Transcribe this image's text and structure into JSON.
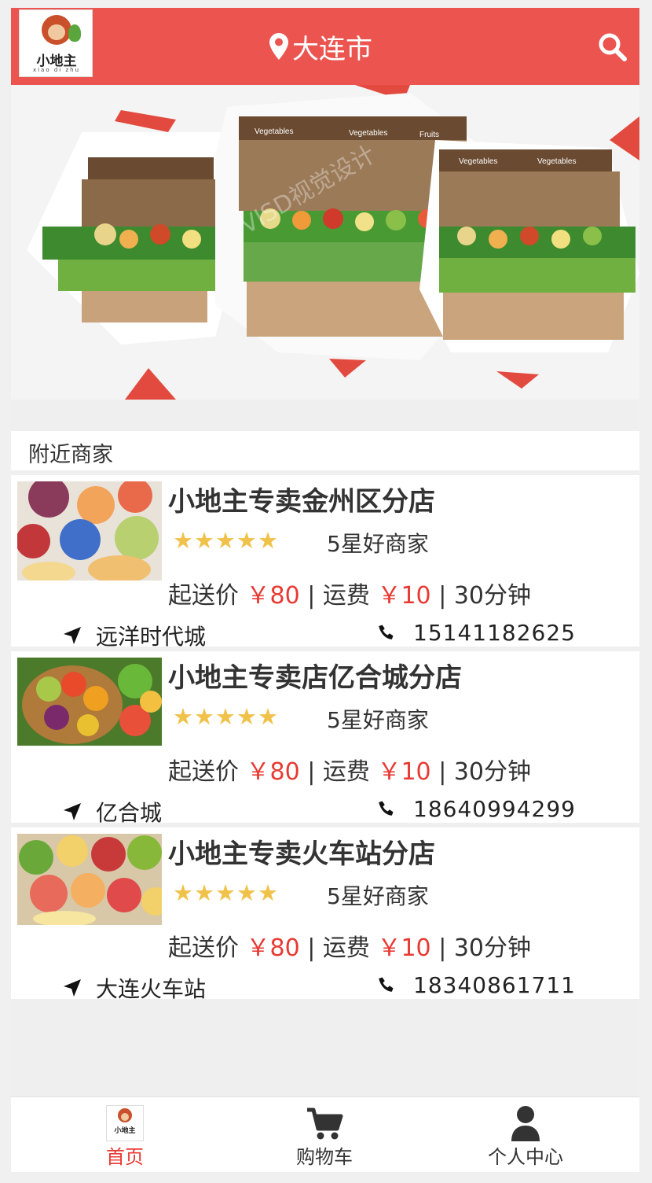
{
  "header": {
    "logo_text": "小地主",
    "logo_subtext": "xiao di zhu",
    "city": "大连市"
  },
  "banner": {
    "shelf_labels": [
      "Vegetables",
      "Vegetables",
      "Fruits",
      "Vegetables",
      "Vegetables"
    ],
    "watermark": "VISD视觉设计"
  },
  "section": {
    "title": "附近商家"
  },
  "stores": [
    {
      "name": "小地主专卖金州区分店",
      "stars": "★★★★★",
      "rating": "5星好商家",
      "min_label": "起送价",
      "min_price": "￥80",
      "sep1": " | ",
      "fee_label": "运费",
      "fee": "￥10",
      "sep2": " | ",
      "time": "30分钟",
      "address": "远洋时代城",
      "phone": "15141182625",
      "thumb_colors": [
        "#f2a45a",
        "#e8c28a",
        "#3f6fc8",
        "#c2373a",
        "#8ab050"
      ]
    },
    {
      "name": "小地主专卖店亿合城分店",
      "stars": "★★★★★",
      "rating": "5星好商家",
      "min_label": "起送价",
      "min_price": "￥80",
      "sep1": " | ",
      "fee_label": "运费",
      "fee": "￥10",
      "sep2": " | ",
      "time": "30分钟",
      "address": "亿合城",
      "phone": "18640994299",
      "thumb_colors": [
        "#6aa83a",
        "#e84a2a",
        "#f0a020",
        "#7a2a6a",
        "#3e8a2a"
      ]
    },
    {
      "name": "小地主专卖火车站分店",
      "stars": "★★★★★",
      "rating": "5星好商家",
      "min_label": "起送价",
      "min_price": "￥80",
      "sep1": " | ",
      "fee_label": "运费",
      "fee": "￥10",
      "sep2": " | ",
      "time": "30分钟",
      "address": "大连火车站",
      "phone": "18340861711",
      "thumb_colors": [
        "#e86a5a",
        "#f2d06a",
        "#c83a3a",
        "#88b83a",
        "#f4b060"
      ]
    }
  ],
  "tabbar": {
    "items": [
      {
        "label": "首页",
        "icon": "logo-icon",
        "active": true
      },
      {
        "label": "购物车",
        "icon": "cart-icon"
      },
      {
        "label": "个人中心",
        "icon": "user-icon"
      }
    ]
  },
  "colors": {
    "brand_red": "#ec5450",
    "price_red": "#e83a33",
    "star_gold": "#f0c24a"
  }
}
